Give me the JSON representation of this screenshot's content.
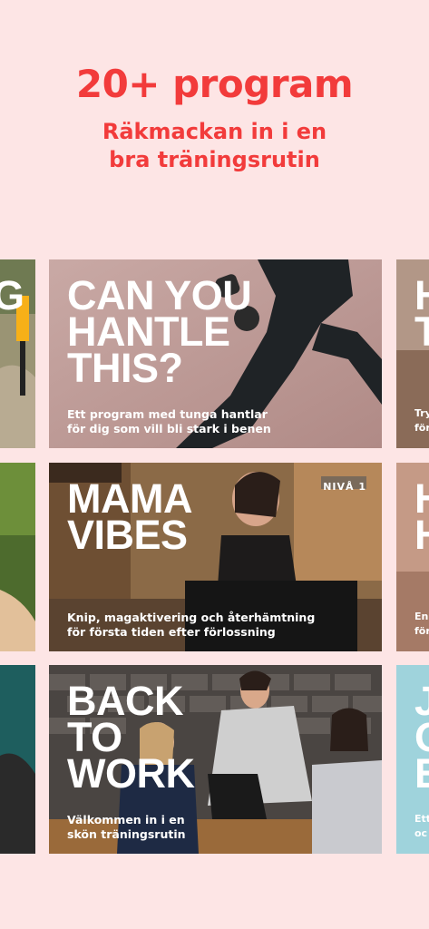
{
  "hero": {
    "title": "20+ program",
    "subtitle_line1": "Räkmackan in i en",
    "subtitle_line2": "bra träningsrutin"
  },
  "programs": [
    {
      "title_lines": [
        "CAN YOU",
        "HANTLE",
        "THIS?"
      ],
      "desc_line1": "Ett program med tunga hantlar",
      "desc_line2": "för dig som vill bli stark i benen"
    },
    {
      "title_lines": [
        "MAMA",
        "VIBES"
      ],
      "badge": "NIVÅ 1",
      "desc_line1": "Knip, magaktivering och återhämtning",
      "desc_line2": "för första tiden efter förlossning"
    },
    {
      "title_lines": [
        "BACK",
        "TO",
        "WORK"
      ],
      "desc_line1": "Välkommen in i en",
      "desc_line2": "skön träningsrutin"
    }
  ],
  "peeks": {
    "row1_left": "G",
    "row1_right": "H\nT",
    "row1_right_small": "Try\nför",
    "row2_right": "H\nH",
    "row2_right_small": "En\nför",
    "row3_right": "J\nO\nE",
    "row3_right_small": "Ett\noc"
  },
  "colors": {
    "background": "#fde5e5",
    "accent": "#f23b3b"
  }
}
